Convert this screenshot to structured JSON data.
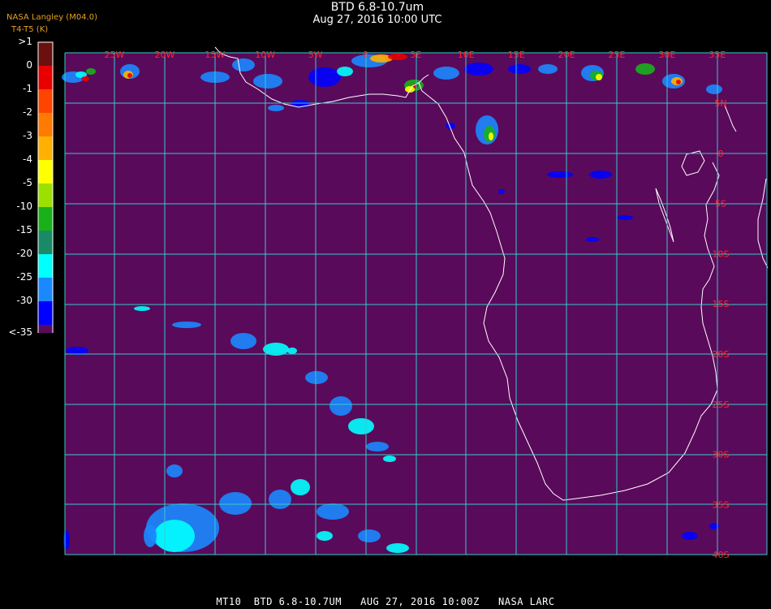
{
  "header": {
    "title": "BTD 6.8-10.7um",
    "subtitle": "Aug 27, 2016 10:00 UTC",
    "credit": "NASA Langley (M04.0)",
    "units": "T4-T5 (K)"
  },
  "colorbar": {
    "labels": [
      ">1",
      "0",
      "-1",
      "-2",
      "-3",
      "-4",
      "-5",
      "-10",
      "-15",
      "-20",
      "-25",
      "-30",
      "<-35"
    ],
    "colors": [
      "#6a1010",
      "#e80000",
      "#ff4400",
      "#ff7a00",
      "#ffb000",
      "#ffff00",
      "#9be000",
      "#19b019",
      "#1a8a66",
      "#00ffff",
      "#1a88ff",
      "#0000ff",
      "#5a0a5a"
    ]
  },
  "map": {
    "background_color": "#5a0a5a",
    "grid_color": "#33cccc",
    "label_color": "#ff2a2a",
    "coast_color": "#ffffff",
    "lon_labels": [
      "25W",
      "20W",
      "15W",
      "10W",
      "5W",
      "0",
      "5E",
      "10E",
      "15E",
      "20E",
      "25E",
      "30E",
      "35E"
    ],
    "lat_labels": [
      "5N",
      "0",
      "5S",
      "10S",
      "15S",
      "20S",
      "25S",
      "30S",
      "35S",
      "40S"
    ]
  },
  "footer": {
    "text": "MT10  BTD 6.8-10.7UM   AUG 27, 2016 10:00Z   NASA LARC"
  }
}
